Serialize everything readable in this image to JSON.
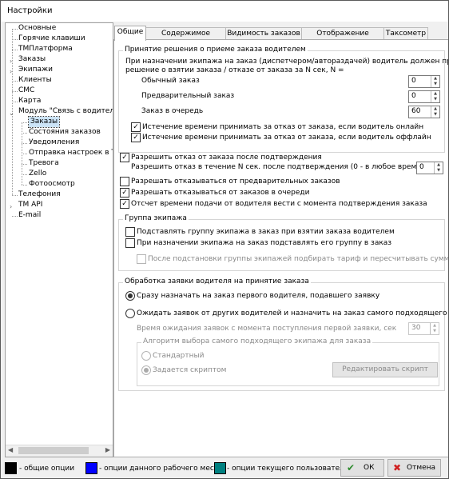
{
  "window": {
    "title": "Настройки"
  },
  "tree": {
    "nodes": [
      {
        "label": "Основные"
      },
      {
        "label": "Горячие клавиши"
      },
      {
        "label": "ТМПлатформа"
      },
      {
        "label": "Заказы"
      },
      {
        "label": "Экипажи"
      },
      {
        "label": "Клиенты"
      },
      {
        "label": "СМС"
      },
      {
        "label": "Карта"
      },
      {
        "label": "Модуль \"Связь с водителем\""
      },
      {
        "label": "Заказы",
        "selected": true
      },
      {
        "label": "Состояния заказов"
      },
      {
        "label": "Уведомления"
      },
      {
        "label": "Отправка настроек в ТМДрайвер"
      },
      {
        "label": "Тревога"
      },
      {
        "label": "Zello"
      },
      {
        "label": "Фотоосмотр"
      },
      {
        "label": "Телефония"
      },
      {
        "label": "TM API"
      },
      {
        "label": "E-mail"
      }
    ]
  },
  "tabs": [
    {
      "label": "Общие",
      "active": true
    },
    {
      "label": "Содержимое заказов"
    },
    {
      "label": "Видимость заказов"
    },
    {
      "label": "Отображение заказов"
    },
    {
      "label": "Таксометр"
    }
  ],
  "g1": {
    "title": "Принятие решения о приеме заказа водителем",
    "desc1": "При назначении экипажа на заказ (диспетчером/автораздачей) водитель должен принять",
    "desc2": "решение о взятии заказа / отказе от заказа за N сек, N =",
    "regular_label": "Обычный заказ",
    "regular_value": "0",
    "prelim_label": "Предварительный заказ",
    "prelim_value": "0",
    "queue_label": "Заказ в очередь",
    "queue_value": "60",
    "expire_online": "Истечение времени принимать за отказ от заказа, если водитель онлайн",
    "expire_offline": "Истечение времени принимать за отказ от заказа, если водитель оффлайн"
  },
  "opts": {
    "allow_refuse": "Разрешить отказ от заказа после подтверждения",
    "refuse_within": "Разрешить отказ в течение N сек. после подтверждения (0 - в любое время), N =",
    "refuse_within_value": "0",
    "allow_prelim": "Разрешать отказываться от предварительных заказов",
    "allow_queue": "Разрешать отказываться от заказов в очереди",
    "count_time": "Отсчет времени подачи от водителя вести с момента подтверждения заказа"
  },
  "g2": {
    "title": "Группа экипажа",
    "opt1": "Подставлять группу экипажа в заказ при взятии заказа водителем",
    "opt2": "При назначении экипажа на заказ подставлять его группу в заказ",
    "opt3": "После подстановки группы экипажей подбирать тариф и пересчитывать сумму заказа"
  },
  "g3": {
    "title": "Обработка заявки водителя на принятие заказа",
    "radio1": "Сразу назначать на заказ первого водителя, подавшего заявку",
    "radio2": "Ожидать заявок от других водителей и назначить на заказ самого подходящего водителя",
    "wait_label": "Время ожидания заявок с момента поступления первой заявки, сек",
    "wait_value": "30",
    "algo_title": "Алгоритм выбора самого подходящего экипажа для заказа",
    "algo_standard": "Стандартный",
    "algo_script": "Задается скриптом",
    "edit_script": "Редактировать скрипт"
  },
  "footer": {
    "legend_common": "- общие опции",
    "legend_workplace": "- опции данного рабочего места",
    "legend_user": "- опции текущего пользователя",
    "color_common": "#000000",
    "color_workplace": "#0000ff",
    "color_user": "#008080",
    "ok": "ОК",
    "cancel": "Отмена"
  }
}
